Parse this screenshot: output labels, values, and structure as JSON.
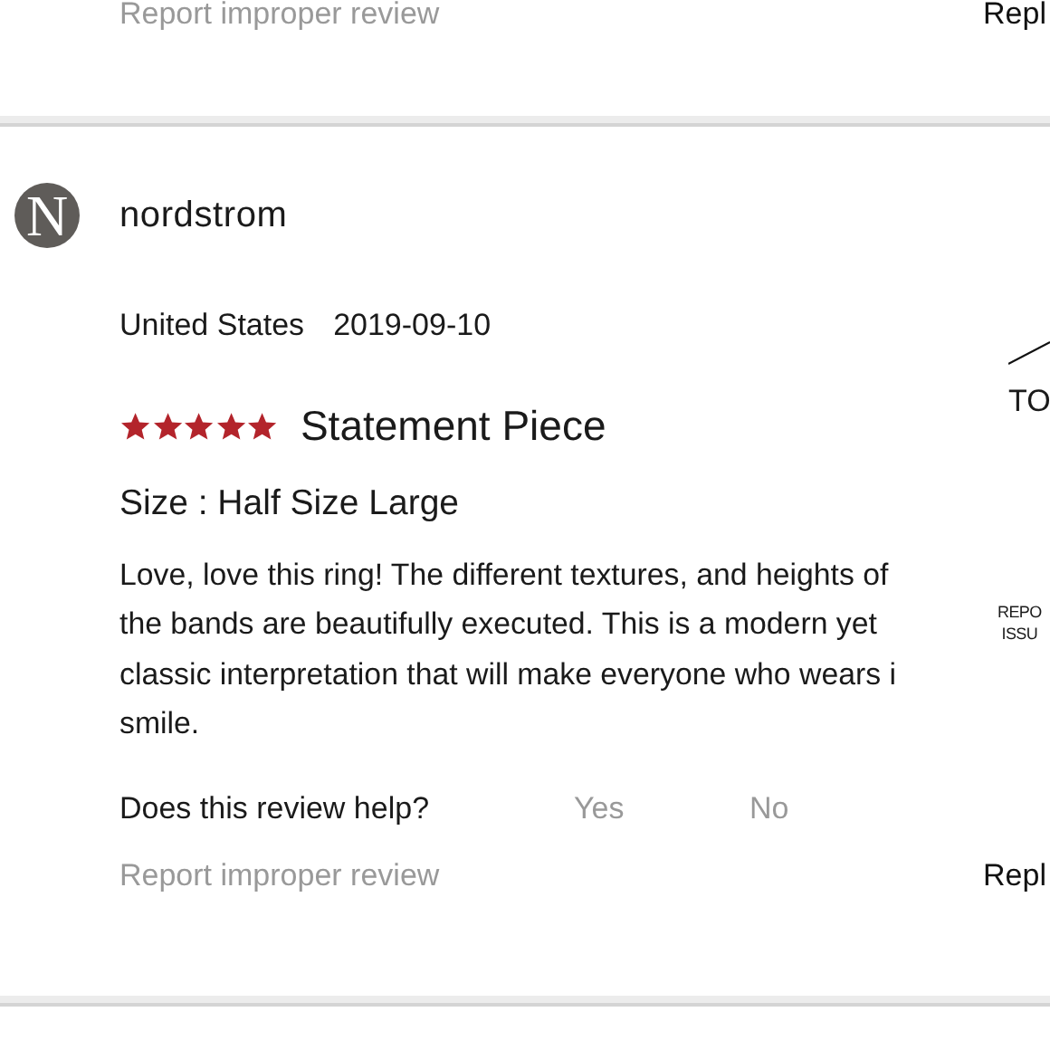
{
  "previous_review": {
    "report_link": "Report improper review",
    "reply_link": "Repl"
  },
  "review": {
    "reviewer": {
      "name": "nordstrom",
      "avatar_letter": "N"
    },
    "country": "United States",
    "date": "2019-09-10",
    "stars": 5,
    "title": "Statement Piece",
    "size": "Size : Half Size Large",
    "body": "Love, love this ring! The different textures, and heights of\nthe bands are beautifully executed. This is a modern yet\nclassic interpretation that will make everyone who wears i\nsmile.",
    "helpful": {
      "question": "Does this review help?",
      "yes": "Yes",
      "no": "No"
    },
    "report_link": "Report improper review",
    "reply_link": "Repl"
  },
  "side_column": {
    "top_label": "TO",
    "report_label": "REPO\nISSU"
  }
}
